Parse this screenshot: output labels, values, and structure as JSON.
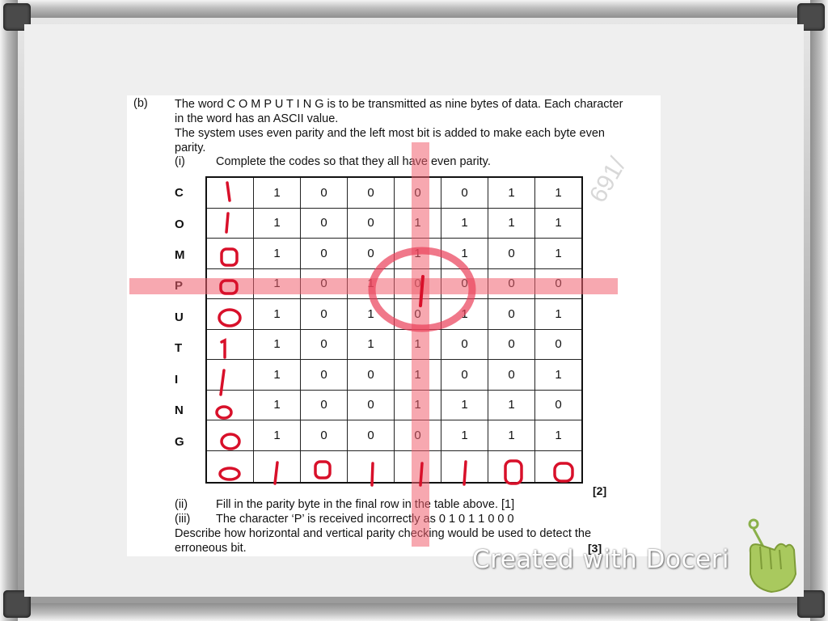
{
  "question": {
    "part_label": "(b)",
    "intro_lines": [
      "The word C O M P U T I N G is to be transmitted as nine bytes of data. Each character",
      "in the word has an ASCII value.",
      "The system uses even parity and the left most bit is added to make each byte even",
      "parity."
    ],
    "i_label": "(i)",
    "i_text": "Complete the codes so that they all have even parity.",
    "ii_label": "(ii)",
    "ii_text": "Fill in the parity byte in the final row in the table above. [1]",
    "iii_label": "(iii)",
    "iii_text": "The character ‘P’ is received incorrectly as 0 1 0 1 1 0 0 0",
    "describe_line1": "Describe how horizontal and vertical parity checking would be used to detect the",
    "describe_line2": "erroneous bit.",
    "mark_2": "[2]",
    "mark_3": "[3]",
    "watermark": "691/"
  },
  "table": {
    "rows": [
      {
        "char": "C",
        "parity": "1",
        "bits": [
          "1",
          "0",
          "0",
          "0",
          "0",
          "1",
          "1"
        ]
      },
      {
        "char": "O",
        "parity": "1",
        "bits": [
          "1",
          "0",
          "0",
          "1",
          "1",
          "1",
          "1"
        ]
      },
      {
        "char": "M",
        "parity": "0",
        "bits": [
          "1",
          "0",
          "0",
          "1",
          "1",
          "0",
          "1"
        ]
      },
      {
        "char": "P",
        "parity": "0",
        "bits": [
          "1",
          "0",
          "1",
          "0",
          "0",
          "0",
          "0"
        ]
      },
      {
        "char": "U",
        "parity": "0",
        "bits": [
          "1",
          "0",
          "1",
          "0",
          "1",
          "0",
          "1"
        ]
      },
      {
        "char": "T",
        "parity": "1",
        "bits": [
          "1",
          "0",
          "1",
          "1",
          "0",
          "0",
          "0"
        ]
      },
      {
        "char": "I",
        "parity": "1",
        "bits": [
          "1",
          "0",
          "0",
          "1",
          "0",
          "0",
          "1"
        ]
      },
      {
        "char": "N",
        "parity": "0",
        "bits": [
          "1",
          "0",
          "0",
          "1",
          "1",
          "1",
          "0"
        ]
      },
      {
        "char": "G",
        "parity": "0",
        "bits": [
          "1",
          "0",
          "0",
          "0",
          "1",
          "1",
          "1"
        ]
      }
    ],
    "parity_byte": [
      "0",
      "1",
      "0",
      "1",
      "1",
      "1",
      "0",
      "0"
    ]
  },
  "branding": {
    "text": "Created with Doceri"
  },
  "colors": {
    "ink_red": "#d8102a",
    "highlight_red": "#f06070"
  }
}
